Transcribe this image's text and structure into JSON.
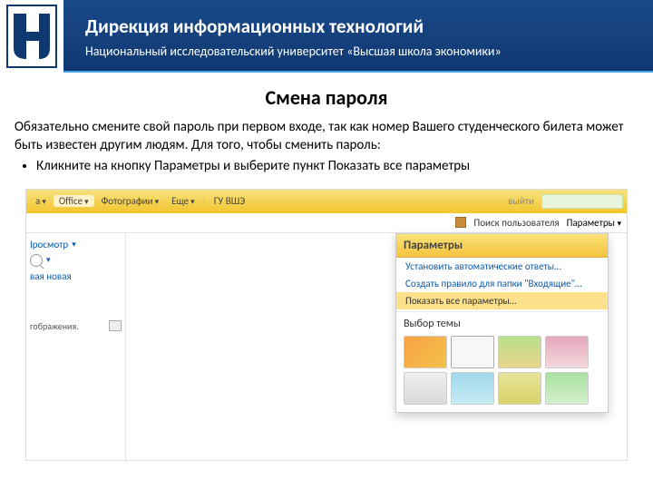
{
  "header": {
    "title": "Дирекция информационных технологий",
    "subtitle": "Национальный исследовательский университет «Высшая школа экономики»"
  },
  "page": {
    "title": "Смена пароля",
    "intro": "Обязательно смените свой пароль при первом входе, так как номер Вашего студенческого билета может быть известен другим людям. Для того, чтобы сменить пароль:",
    "bullet": "Кликните на кнопку Параметры и выберите пункт Показать все параметры"
  },
  "nav": {
    "items": [
      "а",
      "Office",
      "Фотографии",
      "Еще",
      "|",
      "ГУ ВШЭ"
    ],
    "exit": "выйти",
    "find_user": "Поиск пользователя",
    "params": "Параметры"
  },
  "side": {
    "view": "Iросмотр",
    "new": "вая новая",
    "images": "гображения."
  },
  "panel": {
    "title": "Параметры",
    "link1": "Установить автоматические ответы…",
    "link2": "Создать правило для папки \"Входящие\"…",
    "link3": "Показать все параметры…",
    "theme_label": "Выбор темы"
  }
}
